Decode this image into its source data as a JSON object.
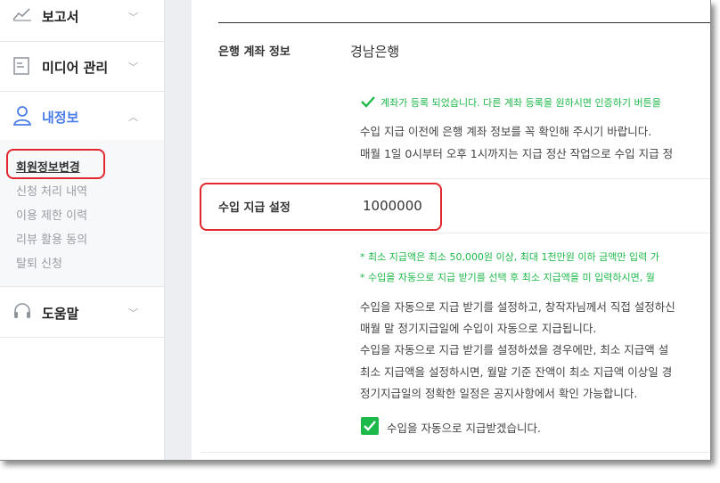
{
  "sidebar": {
    "items": [
      {
        "label": "보고서",
        "icon": "chart-line-icon"
      },
      {
        "label": "미디어 관리",
        "icon": "media-icon"
      },
      {
        "label": "내정보",
        "icon": "user-icon"
      },
      {
        "label": "도움말",
        "icon": "headset-icon"
      }
    ],
    "submenu": [
      "회원정보변경",
      "신청 처리 내역",
      "이용 제한 이력",
      "리뷰 활용 동의",
      "탈퇴 신청"
    ]
  },
  "bank": {
    "label": "은행 계좌 정보",
    "value": "경남은행",
    "registered_msg": "계좌가 등록 되었습니다. 다른 계좌 등록을 원하시면 인증하기 버튼을",
    "notes": [
      "수입 지급 이전에 은행 계좌 정보를 꼭 확인해 주시기 바랍니다.",
      "매월 1일 0시부터 오후 1시까지는 지급 정산 작업으로 수입 지급 정"
    ]
  },
  "payout": {
    "label": "수입 지급 설정",
    "value": "1000000",
    "green_notes": [
      "* 최소 지급액은 최소 50,000원 이상, 최대 1천만원 이하 금액만 입력 가",
      "* 수입을 자동으로 지급 받기를 선택 후 최소 지급액을 미 입력하시면, 월"
    ],
    "notes": [
      "수입을 자동으로 지급 받기를 설정하고, 창작자님께서 직접 설정하신",
      "매월 말 정기지급일에 수입이 자동으로 지급됩니다.",
      "수입을 자동으로 지급 받기를 설정하셨을 경우에만, 최소 지급액 설",
      "최소 지급액을 설정하시면, 월말 기준 잔액이 최소 지급액 이상일 경",
      "정기지급일의 정확한 일정은 공지사항에서 확인 가능합니다."
    ],
    "auto_label": "수입을 자동으로 지급받겠습니다.",
    "auto_checked": true
  },
  "colors": {
    "accent": "#1fb84a",
    "highlight": "#e0282e",
    "active_blue": "#4a7de8"
  }
}
